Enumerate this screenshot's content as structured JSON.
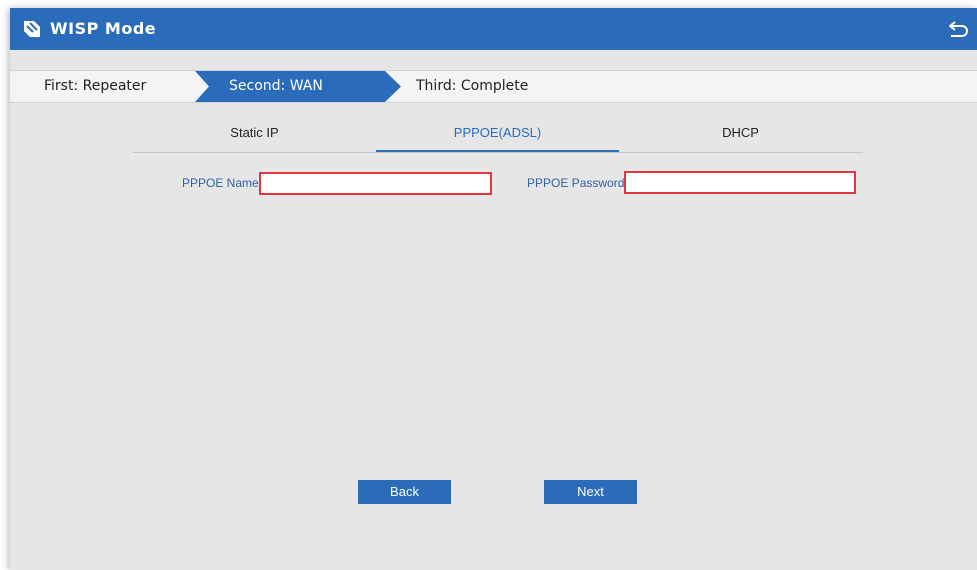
{
  "header": {
    "title": "WISP Mode",
    "logo_icon": "brand-logo-icon",
    "back_icon": "return-arrow-icon"
  },
  "steps": [
    {
      "label": "First: Repeater",
      "active": false
    },
    {
      "label": "Second: WAN",
      "active": true
    },
    {
      "label": "Third: Complete",
      "active": false
    }
  ],
  "tabs": [
    {
      "label": "Static IP",
      "active": false
    },
    {
      "label": "PPPOE(ADSL)",
      "active": true
    },
    {
      "label": "DHCP",
      "active": false
    }
  ],
  "form": {
    "name_label": "PPPOE Name",
    "name_value": "",
    "password_label": "PPPOE Password",
    "password_value": ""
  },
  "buttons": {
    "back": "Back",
    "next": "Next"
  },
  "colors": {
    "accent": "#2a6cba",
    "background": "#e6e6e6",
    "error_border": "#e0393d"
  }
}
